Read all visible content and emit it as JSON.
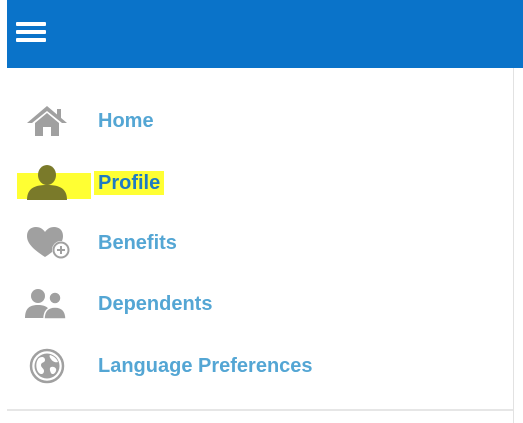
{
  "header": {
    "menu_icon": "hamburger-menu-icon",
    "bar_color": "#0a73c9"
  },
  "sidebar": {
    "items": [
      {
        "label": "Home",
        "icon": "home-icon",
        "highlighted": false
      },
      {
        "label": "Profile",
        "icon": "user-icon",
        "highlighted": true
      },
      {
        "label": "Benefits",
        "icon": "heart-plus-icon",
        "highlighted": false
      },
      {
        "label": "Dependents",
        "icon": "people-icon",
        "highlighted": false
      },
      {
        "label": "Language Preferences",
        "icon": "globe-icon",
        "highlighted": false
      }
    ]
  },
  "colors": {
    "link": "#54a6d4",
    "icon": "#9a9a9a",
    "highlight": "#ffff33"
  }
}
